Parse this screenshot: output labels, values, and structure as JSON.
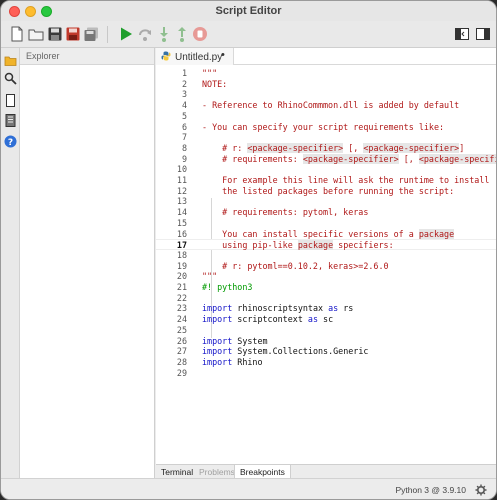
{
  "window": {
    "title": "Script Editor"
  },
  "toolbar": {
    "left_tools": [
      "new-file-icon",
      "open-file-icon",
      "save-icon",
      "save-as-icon",
      "save-all-icon"
    ],
    "run_tools": [
      "run-icon",
      "step-over-icon",
      "step-into-icon",
      "step-out-icon",
      "stop-icon"
    ],
    "right_tools": [
      "toggle-panel-icon",
      "toggle-sidebar-icon"
    ]
  },
  "sidebar": {
    "icons": [
      "folder-icon",
      "search-icon",
      "document-icon",
      "library-icon",
      "help-icon"
    ],
    "explorer_label": "Explorer"
  },
  "editor": {
    "tab_label": "Untitled.py",
    "tab_dirty_marker": "•",
    "current_line": 17,
    "lines": [
      {
        "n": "1",
        "parts": [
          {
            "t": "\"\"\"",
            "c": "str"
          }
        ]
      },
      {
        "n": "2",
        "parts": [
          {
            "t": "NOTE:",
            "c": "str"
          }
        ]
      },
      {
        "n": "3",
        "parts": []
      },
      {
        "n": "4",
        "parts": [
          {
            "t": "- Reference to RhinoCommmon.dll is added by default",
            "c": "str"
          }
        ]
      },
      {
        "n": "5",
        "parts": []
      },
      {
        "n": "6",
        "parts": [
          {
            "t": "- You can specify your script requirements like:",
            "c": "str"
          }
        ]
      },
      {
        "n": "7",
        "parts": []
      },
      {
        "n": "8",
        "parts": [
          {
            "t": "    # r: ",
            "c": "str"
          },
          {
            "t": "<package-specifier>",
            "c": "str",
            "h": true
          },
          {
            "t": " [, ",
            "c": "str"
          },
          {
            "t": "<package-specifier>",
            "c": "str",
            "h": true
          },
          {
            "t": "]",
            "c": "str"
          }
        ]
      },
      {
        "n": "9",
        "parts": [
          {
            "t": "    # requirements: ",
            "c": "str"
          },
          {
            "t": "<package-specifier>",
            "c": "str",
            "h": true
          },
          {
            "t": " [, ",
            "c": "str"
          },
          {
            "t": "<package-specifier>",
            "c": "str",
            "h": true
          },
          {
            "t": "]",
            "c": "str"
          }
        ]
      },
      {
        "n": "10",
        "parts": []
      },
      {
        "n": "11",
        "parts": [
          {
            "t": "    For example this line will ask the runtime to install",
            "c": "str"
          }
        ]
      },
      {
        "n": "12",
        "parts": [
          {
            "t": "    the listed packages before running the script:",
            "c": "str"
          }
        ]
      },
      {
        "n": "13",
        "parts": []
      },
      {
        "n": "14",
        "parts": [
          {
            "t": "    # requirements: pytoml, keras",
            "c": "str"
          }
        ]
      },
      {
        "n": "15",
        "parts": []
      },
      {
        "n": "16",
        "parts": [
          {
            "t": "    You can install specific versions of a ",
            "c": "str"
          },
          {
            "t": "package",
            "c": "str",
            "h": true
          }
        ]
      },
      {
        "n": "17",
        "parts": [
          {
            "t": "    using pip-like ",
            "c": "str"
          },
          {
            "t": "package",
            "c": "str",
            "h": true
          },
          {
            "t": " specifiers:",
            "c": "str"
          }
        ]
      },
      {
        "n": "18",
        "parts": []
      },
      {
        "n": "19",
        "parts": [
          {
            "t": "    # r: pytoml==0.10.2, keras>=2.6.0",
            "c": "str"
          }
        ]
      },
      {
        "n": "20",
        "parts": [
          {
            "t": "\"\"\"",
            "c": "str"
          }
        ]
      },
      {
        "n": "21",
        "parts": [
          {
            "t": "#! python3",
            "c": "cmt"
          }
        ]
      },
      {
        "n": "22",
        "parts": []
      },
      {
        "n": "23",
        "parts": [
          {
            "t": "import",
            "c": "kw"
          },
          {
            "t": " rhinoscriptsyntax ",
            "c": "plain"
          },
          {
            "t": "as",
            "c": "kw"
          },
          {
            "t": " rs",
            "c": "plain"
          }
        ]
      },
      {
        "n": "24",
        "parts": [
          {
            "t": "import",
            "c": "kw"
          },
          {
            "t": " scriptcontext ",
            "c": "plain"
          },
          {
            "t": "as",
            "c": "kw"
          },
          {
            "t": " sc",
            "c": "plain"
          }
        ]
      },
      {
        "n": "25",
        "parts": []
      },
      {
        "n": "26",
        "parts": [
          {
            "t": "import",
            "c": "kw"
          },
          {
            "t": " System",
            "c": "plain"
          }
        ]
      },
      {
        "n": "27",
        "parts": [
          {
            "t": "import",
            "c": "kw"
          },
          {
            "t": " System.Collections.Generic",
            "c": "plain"
          }
        ]
      },
      {
        "n": "28",
        "parts": [
          {
            "t": "import",
            "c": "kw"
          },
          {
            "t": " Rhino",
            "c": "plain"
          }
        ]
      },
      {
        "n": "29",
        "parts": []
      }
    ]
  },
  "bottom_panel": {
    "tabs": [
      {
        "label": "Terminal",
        "state": "normal"
      },
      {
        "label": "Problems",
        "state": "disabled"
      },
      {
        "label": "Breakpoints",
        "state": "selected"
      }
    ]
  },
  "status": {
    "runtime": "Python 3 @ 3.9.10",
    "icon": "gear-icon"
  },
  "colors": {
    "string": "#b01818",
    "keyword": "#1414c8",
    "comment": "#009a00",
    "run_green": "#1f9e2c",
    "stop_red": "#e0443e"
  }
}
